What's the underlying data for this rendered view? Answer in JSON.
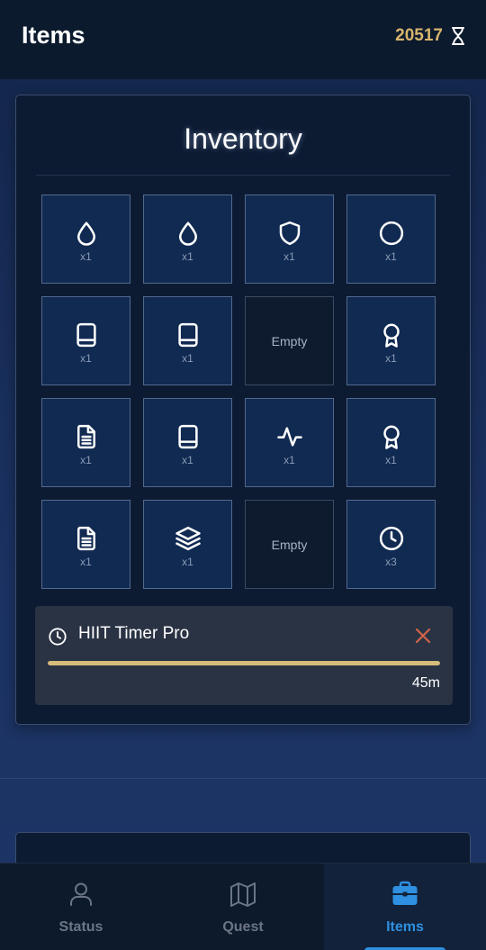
{
  "header": {
    "title": "Items",
    "coins": "20517",
    "coin_icon": "hourglass-icon"
  },
  "inventory": {
    "title": "Inventory",
    "slots": [
      {
        "icon": "drop",
        "qty": "x1"
      },
      {
        "icon": "drop",
        "qty": "x1"
      },
      {
        "icon": "shield",
        "qty": "x1"
      },
      {
        "icon": "circle",
        "qty": "x1"
      },
      {
        "icon": "book",
        "qty": "x1"
      },
      {
        "icon": "book",
        "qty": "x1"
      },
      {
        "icon": "empty",
        "label": "Empty"
      },
      {
        "icon": "award",
        "qty": "x1"
      },
      {
        "icon": "document",
        "qty": "x1"
      },
      {
        "icon": "book",
        "qty": "x1"
      },
      {
        "icon": "activity",
        "qty": "x1"
      },
      {
        "icon": "award",
        "qty": "x1"
      },
      {
        "icon": "document",
        "qty": "x1"
      },
      {
        "icon": "layers",
        "qty": "x1"
      },
      {
        "icon": "empty",
        "label": "Empty"
      },
      {
        "icon": "clock",
        "qty": "x3"
      }
    ],
    "active_item": {
      "icon": "clock",
      "name": "HIIT Timer Pro",
      "progress": 1.0,
      "duration": "45m"
    }
  },
  "tabs": [
    {
      "label": "Status",
      "icon": "user-icon",
      "active": false
    },
    {
      "label": "Quest",
      "icon": "map-icon",
      "active": false
    },
    {
      "label": "Items",
      "icon": "briefcase-icon",
      "active": true
    }
  ],
  "colors": {
    "accent": "#2f8fe0",
    "gold": "#d7b56d",
    "progress": "#d6bc7a",
    "close": "#d0644a"
  }
}
